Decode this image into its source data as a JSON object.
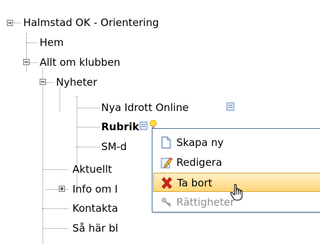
{
  "tree": {
    "root": {
      "label": "Halmstad OK - Orientering"
    },
    "items": [
      {
        "label": "Hem"
      },
      {
        "label": "Allt om klubben"
      },
      {
        "label": "Nyheter"
      },
      {
        "label": "Nya Idrott Online"
      },
      {
        "label": "Rubrik"
      },
      {
        "label": "SM-d"
      },
      {
        "label": "Aktuellt"
      },
      {
        "label": "Info om I"
      },
      {
        "label": "Kontakta"
      },
      {
        "label": "Så här bl"
      }
    ]
  },
  "context_menu": {
    "items": [
      {
        "label": "Skapa ny",
        "icon": "new-document-icon"
      },
      {
        "label": "Redigera",
        "icon": "edit-pencil-icon"
      },
      {
        "label": "Ta bort",
        "icon": "delete-x-icon"
      },
      {
        "label": "Rättigheter",
        "icon": "permissions-icon"
      }
    ]
  },
  "colors": {
    "menu_border": "#4f6f9a",
    "hover_top": "#fff1c8",
    "hover_bottom": "#ffd779",
    "hover_border": "#d9a72e",
    "delete_red": "#d8281c"
  }
}
